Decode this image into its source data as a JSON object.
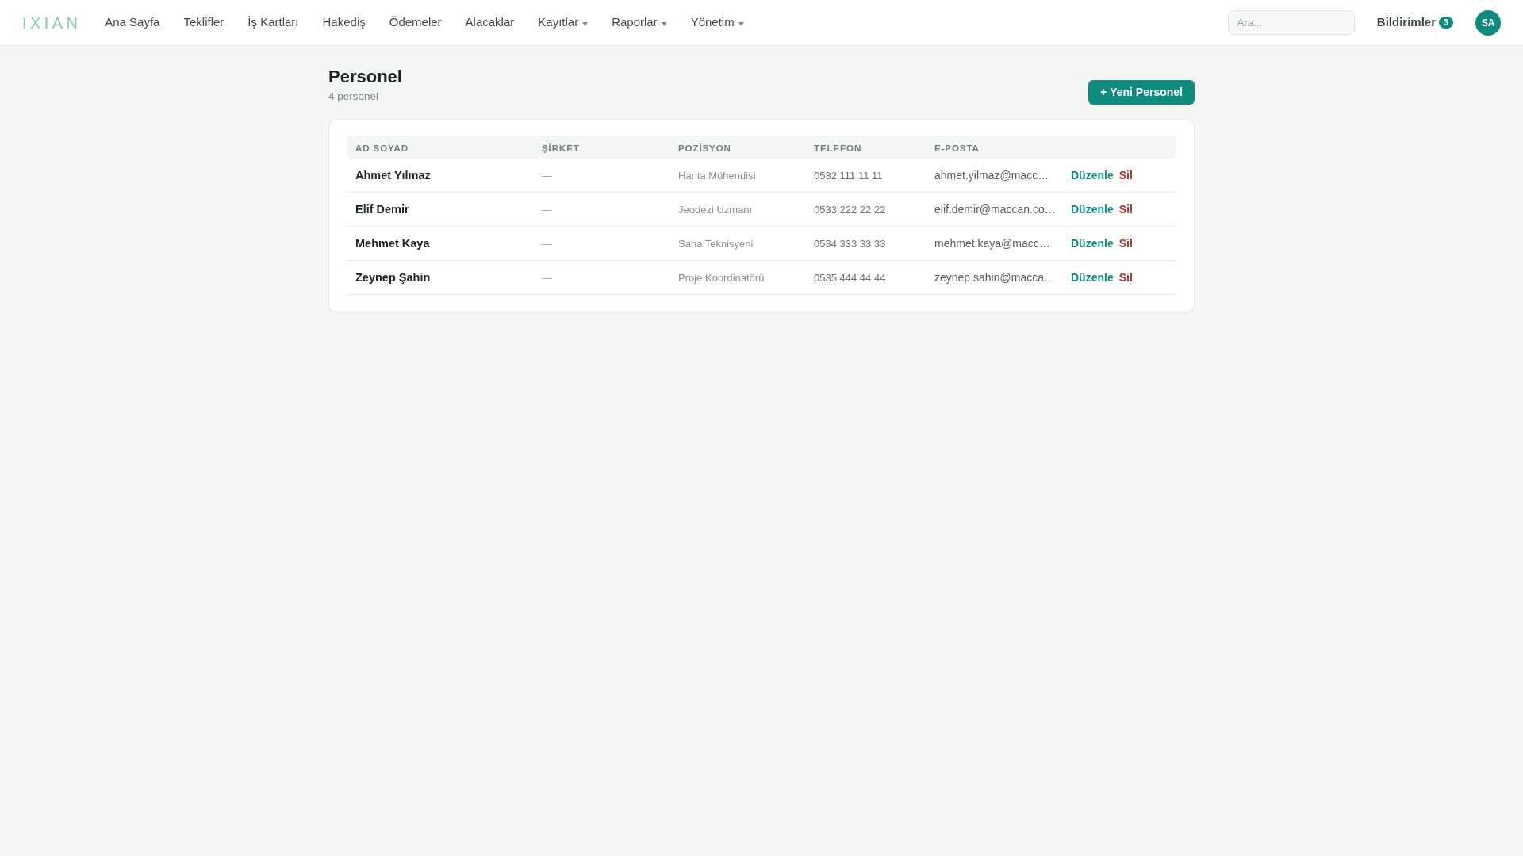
{
  "navbar": {
    "logo": "IXIAN",
    "links": [
      {
        "label": "Ana Sayfa",
        "dropdown": false
      },
      {
        "label": "Teklifler",
        "dropdown": false
      },
      {
        "label": "İş Kartları",
        "dropdown": false
      },
      {
        "label": "Hakediş",
        "dropdown": false
      },
      {
        "label": "Ödemeler",
        "dropdown": false
      },
      {
        "label": "Alacaklar",
        "dropdown": false
      },
      {
        "label": "Kayıtlar",
        "dropdown": true
      },
      {
        "label": "Raporlar",
        "dropdown": true
      },
      {
        "label": "Yönetim",
        "dropdown": true
      }
    ],
    "search": {
      "placeholder": "Ara..."
    },
    "notifications": {
      "label": "Bildirimler",
      "count": "3"
    },
    "avatar": "SA"
  },
  "page": {
    "title": "Personel",
    "subtitle": "4 personel",
    "new_button": "+ Yeni Personel"
  },
  "table": {
    "columns": [
      "AD SOYAD",
      "ŞİRKET",
      "POZİSYON",
      "TELEFON",
      "E-POSTA"
    ],
    "rows": [
      {
        "name": "Ahmet Yılmaz",
        "company": "—",
        "position": "Harita Mühendisi",
        "phone": "0532 111 11 11",
        "email": "ahmet.yilmaz@macc…",
        "actions": [
          {
            "label": "Düzenle",
            "kind": "edit"
          },
          {
            "label": "Sil",
            "kind": "delete"
          }
        ]
      },
      {
        "name": "Elif Demir",
        "company": "—",
        "position": "Jeodezi Uzmanı",
        "phone": "0533 222 22 22",
        "email": "elif.demir@maccan.co…",
        "actions": [
          {
            "label": "Düzenle",
            "kind": "edit"
          },
          {
            "label": "Sil",
            "kind": "delete"
          }
        ]
      },
      {
        "name": "Mehmet Kaya",
        "company": "—",
        "position": "Saha Teknisyeni",
        "phone": "0534 333 33 33",
        "email": "mehmet.kaya@macc…",
        "actions": [
          {
            "label": "Düzenle",
            "kind": "edit"
          },
          {
            "label": "Sil",
            "kind": "delete"
          }
        ]
      },
      {
        "name": "Zeynep Şahin",
        "company": "—",
        "position": "Proje Koordinatörü",
        "phone": "0535 444 44 44",
        "email": "zeynep.sahin@macca…",
        "actions": [
          {
            "label": "Düzenle",
            "kind": "edit"
          },
          {
            "label": "Sil",
            "kind": "delete"
          }
        ]
      }
    ]
  }
}
